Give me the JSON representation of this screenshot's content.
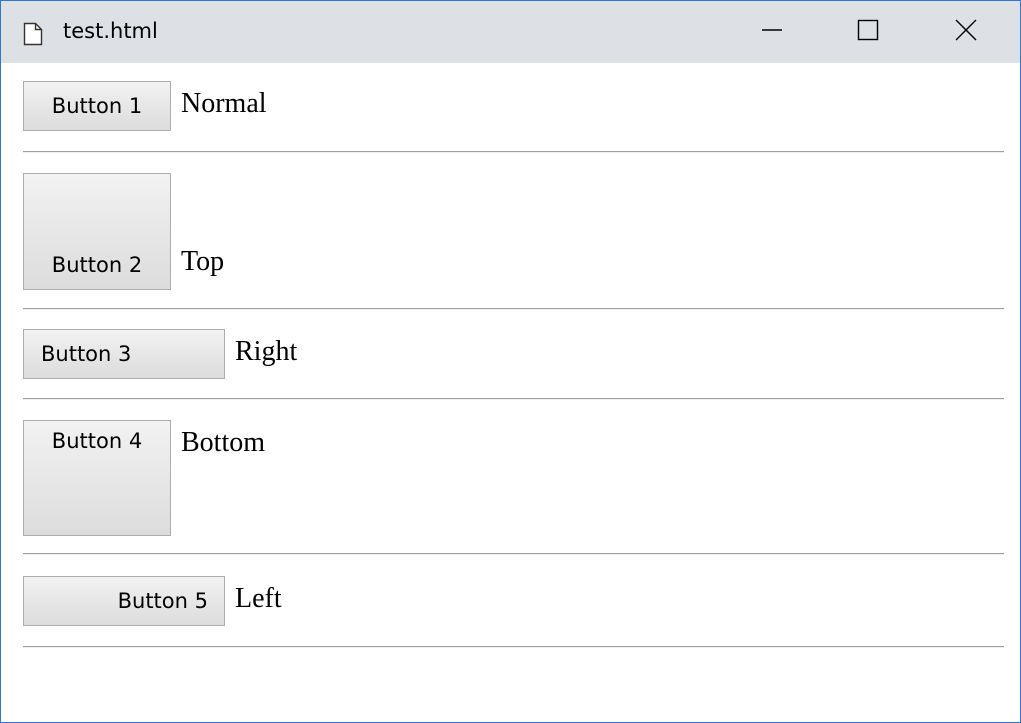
{
  "window": {
    "title": "test.html",
    "controls": {
      "minimize_icon": "minimize-icon",
      "maximize_icon": "maximize-icon",
      "close_icon": "close-icon"
    }
  },
  "rows": [
    {
      "button_label": "Button 1",
      "caption": "Normal"
    },
    {
      "button_label": "Button 2",
      "caption": "Top"
    },
    {
      "button_label": "Button 3",
      "caption": "Right"
    },
    {
      "button_label": "Button 4",
      "caption": "Bottom"
    },
    {
      "button_label": "Button 5",
      "caption": "Left"
    }
  ],
  "colors": {
    "titlebar": "#dde1e6",
    "window_border": "#2b79d0",
    "button_border": "#adadad"
  }
}
